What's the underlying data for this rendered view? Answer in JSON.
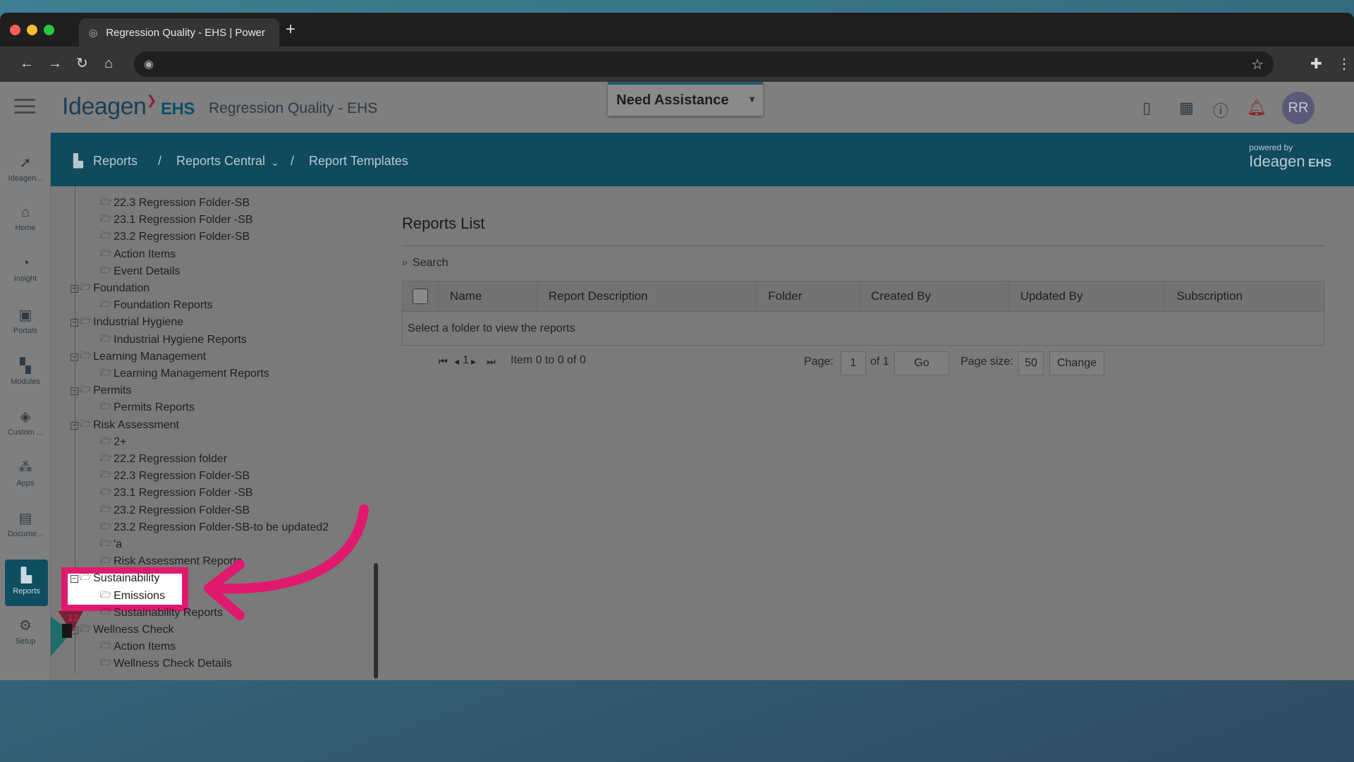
{
  "browser": {
    "tab_title": "Regression Quality - EHS | Power",
    "new_tab": "+"
  },
  "header": {
    "logo_text": "Ideagen",
    "logo_suffix": "EHS",
    "app_title": "Regression Quality - EHS",
    "assist_label": "Need Assistance",
    "avatar_initials": "RR"
  },
  "leftnav": {
    "items": [
      {
        "label": "Ideagen...",
        "icon": "ideagen-icon"
      },
      {
        "label": "Home",
        "icon": "home-icon"
      },
      {
        "label": "Insight",
        "icon": "insight-icon"
      },
      {
        "label": "Portals",
        "icon": "portals-icon"
      },
      {
        "label": "Modules",
        "icon": "modules-icon"
      },
      {
        "label": "Custom ...",
        "icon": "custom-icon"
      },
      {
        "label": "Apps",
        "icon": "apps-icon"
      },
      {
        "label": "Docume...",
        "icon": "documents-icon"
      },
      {
        "label": "Reports",
        "icon": "reports-icon"
      },
      {
        "label": "Setup",
        "icon": "setup-icon"
      }
    ],
    "active": "Reports"
  },
  "breadcrumb": {
    "reports": "Reports",
    "sep1": "/",
    "reports_central": "Reports Central",
    "sep2": "/",
    "report_templates": "Report Templates",
    "powered_by": "powered by",
    "powered_logo": "Ideagen",
    "powered_suffix": "EHS"
  },
  "tree": {
    "nodes": [
      {
        "label": "22.3 Regression Folder-SB",
        "level": 2
      },
      {
        "label": "23.1 Regression Folder -SB",
        "level": 2
      },
      {
        "label": "23.2 Regression Folder-SB",
        "level": 2
      },
      {
        "label": "Action Items",
        "level": 2
      },
      {
        "label": "Event Details",
        "level": 2
      },
      {
        "label": "Foundation",
        "level": 1
      },
      {
        "label": "Foundation Reports",
        "level": 2
      },
      {
        "label": "Industrial Hygiene",
        "level": 1
      },
      {
        "label": "Industrial Hygiene Reports",
        "level": 2
      },
      {
        "label": "Learning Management",
        "level": 1
      },
      {
        "label": "Learning Management Reports",
        "level": 2
      },
      {
        "label": "Permits",
        "level": 1
      },
      {
        "label": "Permits Reports",
        "level": 2
      },
      {
        "label": "Risk Assessment",
        "level": 1
      },
      {
        "label": "2+",
        "level": 2
      },
      {
        "label": "22.2 Regression folder",
        "level": 2
      },
      {
        "label": "22.3 Regression Folder-SB",
        "level": 2
      },
      {
        "label": "23.1 Regression Folder -SB",
        "level": 2
      },
      {
        "label": "23.2 Regression Folder-SB",
        "level": 2
      },
      {
        "label": "23.2 Regression Folder-SB-to be updated2",
        "level": 2
      },
      {
        "label": "'a",
        "level": 2
      },
      {
        "label": "Risk Assessment Reports",
        "level": 2
      },
      {
        "label": "Sustainability",
        "level": 1
      },
      {
        "label": "Emissions",
        "level": 2
      },
      {
        "label": "Sustainability Reports",
        "level": 2
      },
      {
        "label": "Wellness Check",
        "level": 1
      },
      {
        "label": "Action Items",
        "level": 2
      },
      {
        "label": "Wellness Check Details",
        "level": 2
      }
    ],
    "highlighted": [
      "Sustainability",
      "Emissions"
    ],
    "badge": "13"
  },
  "reports_list": {
    "title": "Reports List",
    "search_placeholder": "Search",
    "columns": [
      "Name",
      "Report Description",
      "Folder",
      "Created By",
      "Updated By",
      "Subscription"
    ],
    "empty_message": "Select a folder to view the reports",
    "pager": {
      "current_page_display": "1",
      "item_range": "Item 0 to 0 of 0",
      "page_label": "Page:",
      "page_value": "1",
      "of_total": "of 1",
      "go": "Go",
      "page_size_label": "Page size:",
      "page_size_value": "50",
      "change": "Change"
    }
  },
  "colors": {
    "accent_teal": "#0f4a5e",
    "annotation_pink": "#e0196f"
  }
}
